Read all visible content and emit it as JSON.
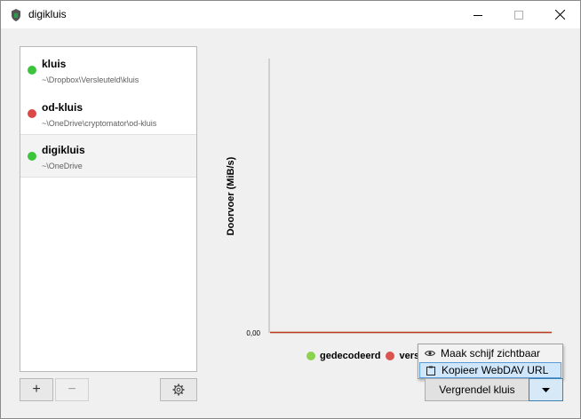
{
  "window": {
    "title": "digikluis"
  },
  "vaults": [
    {
      "name": "kluis",
      "path": "~\\Dropbox\\Versleuteld\\kluis",
      "status_color": "#3cc43c"
    },
    {
      "name": "od-kluis",
      "path": "~\\OneDrive\\cryptomator\\od-kluis",
      "status_color": "#dc4848"
    },
    {
      "name": "digikluis",
      "path": "~\\OneDrive",
      "status_color": "#3cc43c"
    }
  ],
  "toolbar": {
    "add_label": "+",
    "remove_label": "−"
  },
  "chart": {
    "ylabel": "Doorvoer (MiB/s)",
    "ytick": "0,00",
    "legend_decrypted": "gedecodeerd",
    "legend_encrypted_partial": "vers"
  },
  "menu": {
    "items": [
      {
        "label": "Maak schijf zichtbaar",
        "icon": "eye-icon"
      },
      {
        "label": "Kopieer WebDAV URL",
        "icon": "clipboard-icon"
      }
    ]
  },
  "actions": {
    "lock_label": "Vergrendel kluis"
  },
  "colors": {
    "accent": "#3c7fb1",
    "green": "#3cc43c",
    "red": "#dc4848",
    "legend_green": "#8bd34e",
    "legend_red": "#d9534f"
  },
  "chart_data": {
    "type": "line",
    "ylabel": "Doorvoer (MiB/s)",
    "yticks": [
      "0,00"
    ],
    "series": [
      {
        "name": "gedecodeerd",
        "values": [
          0,
          0
        ]
      },
      {
        "name": "vers",
        "values": [
          0,
          0
        ]
      }
    ]
  }
}
